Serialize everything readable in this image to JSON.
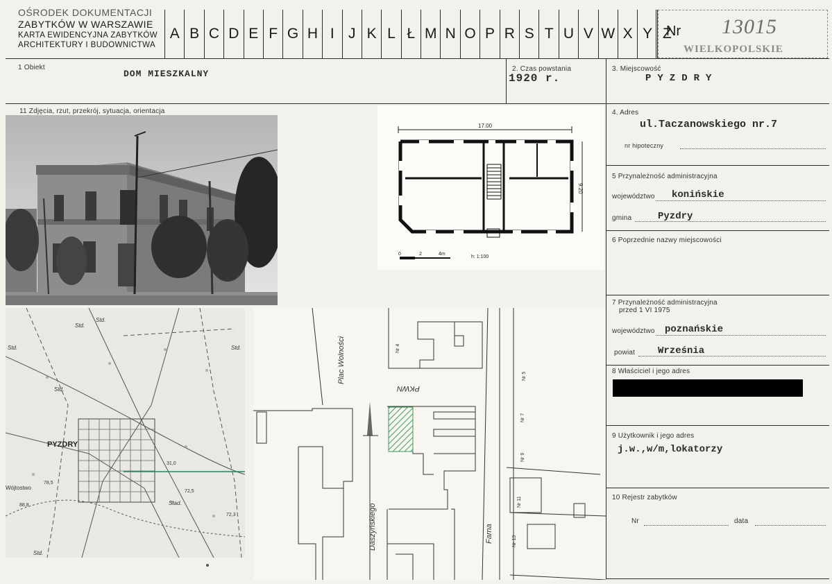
{
  "header": {
    "org_line1": "OŚRODEK DOKUMENTACJI",
    "org_line2": "ZABYTKÓW W WARSZAWIE",
    "form_line1": "KARTA EWIDENCYJNA ZABYTKÓW",
    "form_line2": "ARCHITEKTURY I BUDOWNICTWA",
    "index_letters": [
      "A",
      "B",
      "C",
      "D",
      "E",
      "F",
      "G",
      "H",
      "I",
      "J",
      "K",
      "L",
      "Ł",
      "M",
      "N",
      "O",
      "P",
      "R",
      "S",
      "T",
      "U",
      "V",
      "W",
      "X",
      "Y",
      "Z"
    ],
    "nr_label": "Nr",
    "nr_value": "13015",
    "stamp": "WIELKOPOLSKIE"
  },
  "fields": {
    "obiekt_label": "1 Obiekt",
    "obiekt_value": "DOM MIESZKALNY",
    "czas_label": "2. Czas powstania",
    "czas_value": "1920 r.",
    "miejscowosc_label": "3. Miejscowość",
    "miejscowosc_value": "PYZDRY",
    "adres_label": "4. Adres",
    "adres_value": "ul.Taczanowskiego nr.7",
    "hipoteczny_label": "nr hipoteczny",
    "przynaleznosc_label": "5 Przynależność administracyjna",
    "wojewodztwo_label": "województwo",
    "wojewodztwo_value": "konińskie",
    "gmina_label": "gmina",
    "gmina_value": "Pyzdry",
    "poprzednie_label": "6 Poprzednie nazwy miejscowości",
    "przyn_przed_label": "7 Przynależność administracyjna",
    "przyn_przed_label2": "przed 1 VI 1975",
    "wojewodztwo2_label": "województwo",
    "wojewodztwo2_value": "poznańskie",
    "powiat_label": "powiat",
    "powiat_value": "Września",
    "wlasciciel_label": "8 Właściciel i jego adres",
    "uzytkownik_label": "9 Użytkownik i jego adres",
    "uzytkownik_value": "j.w.,w/m,lokatorzy",
    "rejestr_label": "10 Rejestr zabytków",
    "rejestr_nr_label": "Nr",
    "rejestr_data_label": "data",
    "zdjecia_label": "11 Zdjęcia, rzut, przekrój, sytuacja, orientacja"
  },
  "plan": {
    "dim_width": "17.00",
    "dim_depth": "9.20",
    "scale_labels": [
      "0",
      "2",
      "4m"
    ],
    "scale_ratio": "h: 1:100"
  },
  "map": {
    "town_label": "PYZDRY",
    "labels": [
      "Std.",
      "Std.",
      "Std.",
      "Std.",
      "Std.",
      "Std.",
      "Stad.",
      "Wójtostwo",
      "78,5",
      "88,8",
      "72,5",
      "72,3",
      "31,0"
    ]
  },
  "site": {
    "street_plac": "Plac Wolności",
    "street_daszynskiego": "Daszyńskiego",
    "street_farna": "Farna",
    "street_pkwn": "PKWN",
    "numbers": [
      "Nr 4",
      "Nr 5",
      "Nr 7",
      "Nr 9",
      "Nr 11",
      "Nr 13"
    ]
  },
  "colors": {
    "paper": "#f3f1ec",
    "ink": "#1a1a1a",
    "hatch_green": "#3a9a5a",
    "map_line_green": "#1f8a55"
  }
}
